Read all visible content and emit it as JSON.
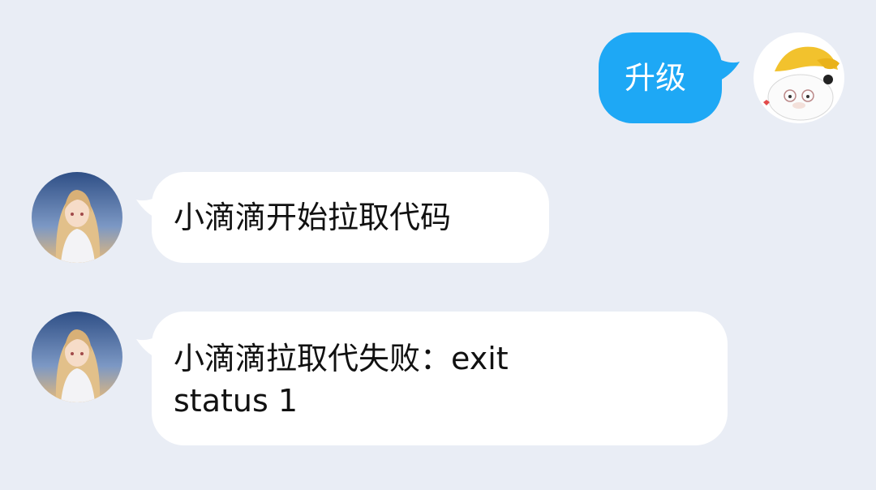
{
  "chat": {
    "messages": [
      {
        "sender": "self",
        "text": "升级"
      },
      {
        "sender": "bot",
        "text": "小滴滴开始拉取代码"
      },
      {
        "sender": "bot",
        "text": "小滴滴拉取代失败：exit status 1"
      }
    ]
  },
  "colors": {
    "background": "#e9edf5",
    "outgoing_bubble": "#1ea8f5",
    "incoming_bubble": "#ffffff"
  },
  "icons": {
    "self_avatar": "cartoon-cat-with-cap-avatar",
    "bot_avatar": "anime-girl-avatar"
  }
}
